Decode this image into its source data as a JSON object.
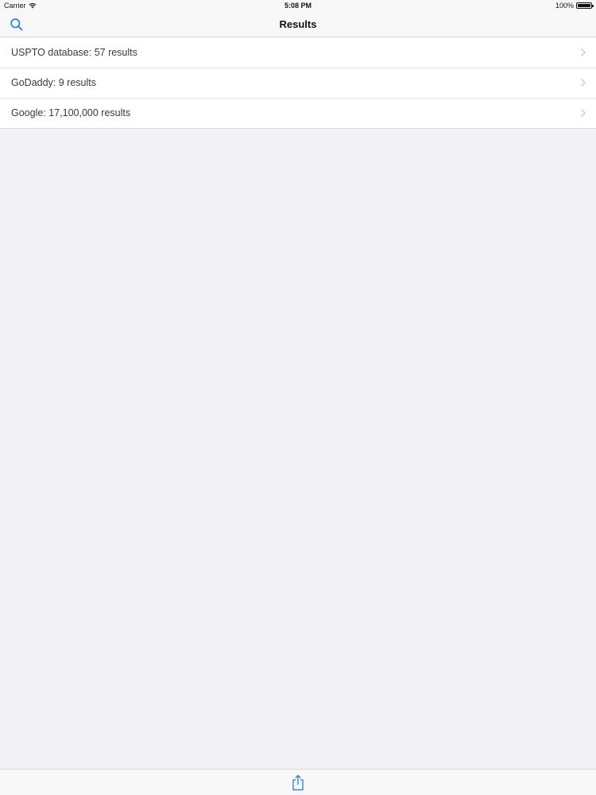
{
  "status_bar": {
    "carrier": "Carrier",
    "time": "5:08 PM",
    "battery": "100%",
    "battery_level": 1.0
  },
  "nav": {
    "title": "Results",
    "left_icon": "search-icon"
  },
  "results": [
    {
      "label": "USPTO database: 57 results"
    },
    {
      "label": "GoDaddy: 9 results"
    },
    {
      "label": "Google: 17,100,000 results"
    }
  ],
  "toolbar": {
    "icon": "share-icon"
  },
  "colors": {
    "accent": "#1a7fe0",
    "background": "#f2f1f6",
    "bar": "#f8f8f8",
    "chevron": "#c7c7cc"
  }
}
